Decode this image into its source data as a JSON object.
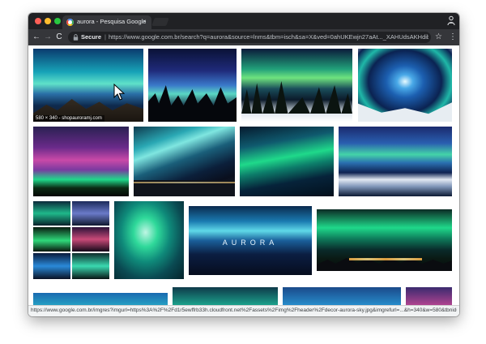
{
  "window": {
    "tab_title": "aurora - Pesquisa Google",
    "tab_close": "×",
    "controls": {
      "back": "←",
      "forward": "→",
      "reload": "C",
      "star": "☆",
      "menu": "⋮"
    }
  },
  "omnibox": {
    "secure_label": "Secure",
    "separator": "|",
    "url": "https://www.google.com.br/search?q=aurora&source=lnms&tbm=isch&sa=X&ved=0ahUKEwjn27aAt..._XAHUdsAKHdibCeoQ_..."
  },
  "results": {
    "hover_dims": "580 × 340 - shopauroramj.com",
    "featured_title": "AURORA"
  },
  "status": {
    "url": "https://www.google.com.br/imgres?imgurl=https%3A%2F%2Fd1r5ewffrb33h.cloudfront.net%2Fassets%2Fimg%2Fheader%2Fdecor-aurora-sky.jpg&imgrefurl=...&h=340&w=580&tbnid=..."
  },
  "colors": {
    "chrome_dark": "#202124",
    "toolbar": "#35363a",
    "aurora_green": "#1fd98a",
    "aurora_teal": "#1aa9b3",
    "aurora_pink": "#c94aa8",
    "night_sky": "#0b1a3a"
  },
  "icons": [
    "back-icon",
    "forward-icon",
    "reload-icon",
    "lock-icon",
    "star-icon",
    "menu-icon",
    "profile-icon",
    "cursor-icon"
  ]
}
